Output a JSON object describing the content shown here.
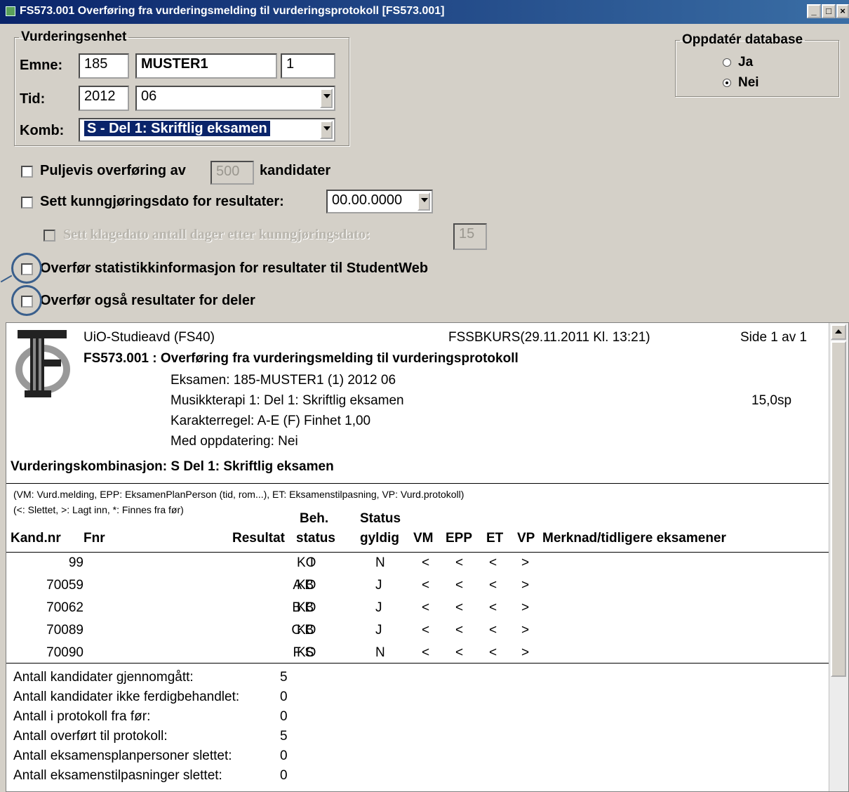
{
  "window": {
    "title": "FS573.001 Overføring fra vurderingsmelding til vurderingsprotokoll [FS573.001]"
  },
  "vurderingsenhet": {
    "legend": "Vurderingsenhet",
    "emne_label": "Emne:",
    "emne_kode": "185",
    "emne_navn": "MUSTER1",
    "emne_versjon": "1",
    "tid_label": "Tid:",
    "tid_aar": "2012",
    "tid_termin": "06",
    "komb_label": "Komb:",
    "komb_value": "S - Del 1: Skriftlig eksamen"
  },
  "oppdater": {
    "legend": "Oppdatér database",
    "ja_label": "Ja",
    "nei_label": "Nei",
    "selected": "Nei"
  },
  "options": {
    "puljevis_label": "Puljevis overføring av",
    "puljevis_value": "500",
    "puljevis_suffix": "kandidater",
    "kunngjoring_label": "Sett kunngjøringsdato for resultater:",
    "kunngjoring_value": "00.00.0000",
    "klagedato_label": "Sett klagedato antall dager etter kunngjøringsdato:",
    "klagedato_value": "15",
    "statistikk_label": "Overfør statistikkinformasjon for resultater til StudentWeb",
    "deler_label": "Overfør også resultater for deler"
  },
  "report": {
    "org": "UiO-Studieavd (FS40)",
    "job": "FSSBKURS(29.11.2011 Kl. 13:21)",
    "page": "Side 1 av 1",
    "title": "FS573.001 :  Overføring fra vurderingsmelding til vurderingsprotokoll",
    "eksamen": "Eksamen:  185-MUSTER1 (1) 2012 06",
    "emnenavn": "Musikkterapi 1: Del 1: Skriftlig eksamen",
    "studiepoeng": "15,0sp",
    "karakterregel": "Karakterregel:  A-E (F) Finhet 1,00",
    "oppdatering": "Med oppdatering: Nei",
    "kombinasjon": "Vurderingskombinasjon: S Del 1: Skriftlig eksamen",
    "legend1": "(VM: Vurd.melding, EPP: EksamenPlanPerson (tid, rom...), ET: Eksamenstilpasning, VP: Vurd.protokoll)",
    "legend2": "(<: Slettet, >: Lagt inn, *: Finnes fra før)",
    "columns": {
      "kandnr": "Kand.nr",
      "fnr": "Fnr",
      "resultat": "Resultat",
      "beh1": "Beh.",
      "beh2": "status",
      "status1": "Status",
      "status2": "gyldig",
      "vm": "VM",
      "epp": "EPP",
      "et": "ET",
      "vp": "VP",
      "merknad": "Merknad/tidligere eksamener"
    },
    "rows": [
      {
        "kandnr": "99",
        "resultat": "I",
        "status": "KO",
        "gyldig": "N",
        "vm": "<",
        "epp": "<",
        "et": "<",
        "vp": ">"
      },
      {
        "kandnr": "70059",
        "resultat": "A B",
        "status": "KO",
        "gyldig": "J",
        "vm": "<",
        "epp": "<",
        "et": "<",
        "vp": ">"
      },
      {
        "kandnr": "70062",
        "resultat": "B B",
        "status": "KO",
        "gyldig": "J",
        "vm": "<",
        "epp": "<",
        "et": "<",
        "vp": ">"
      },
      {
        "kandnr": "70089",
        "resultat": "C B",
        "status": "KO",
        "gyldig": "J",
        "vm": "<",
        "epp": "<",
        "et": "<",
        "vp": ">"
      },
      {
        "kandnr": "70090",
        "resultat": "F S",
        "status": "KO",
        "gyldig": "N",
        "vm": "<",
        "epp": "<",
        "et": "<",
        "vp": ">"
      }
    ],
    "summary": [
      {
        "label": "Antall kandidater gjennomgått:",
        "value": "5"
      },
      {
        "label": "Antall kandidater ikke ferdigbehandlet:",
        "value": "0"
      },
      {
        "label": "Antall i protokoll fra før:",
        "value": "0"
      },
      {
        "label": "Antall overført til protokoll:",
        "value": "5"
      },
      {
        "label": "Antall eksamensplanpersoner slettet:",
        "value": "0"
      },
      {
        "label": "Antall eksamenstilpasninger slettet:",
        "value": "0"
      }
    ]
  },
  "colors": {
    "titlebar": "#0a246a",
    "selection": "#0a246a",
    "annotation_circle": "#3a5f8c"
  }
}
